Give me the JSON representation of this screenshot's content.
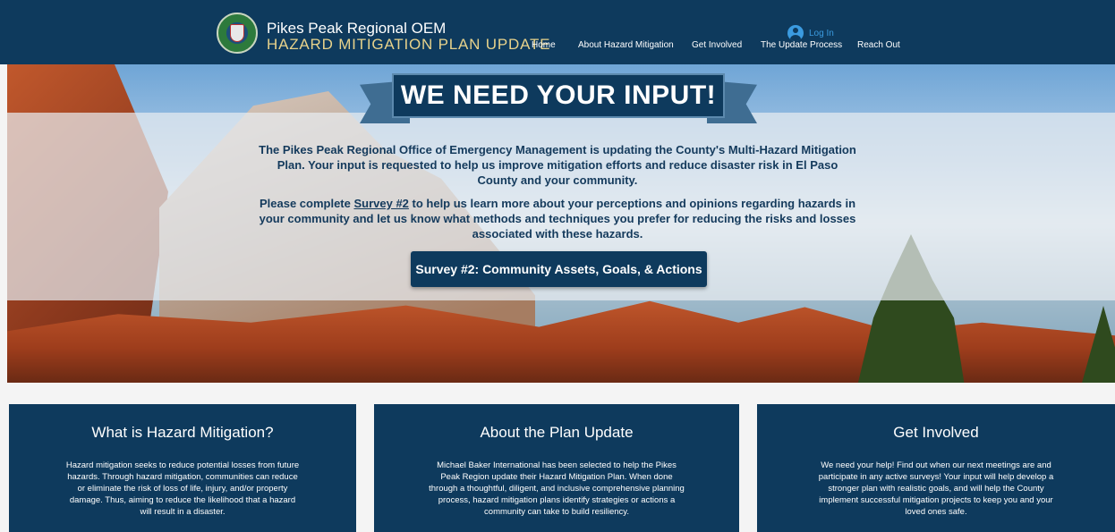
{
  "header": {
    "brand_line1": "Pikes Peak Regional OEM",
    "brand_line2": "HAZARD MITIGATION PLAN UPDATE",
    "nav": [
      "Home",
      "About Hazard Mitigation",
      "Get Involved",
      "The Update Process",
      "Reach Out"
    ],
    "login_label": "Log In"
  },
  "hero": {
    "banner": "WE NEED YOUR INPUT!",
    "paragraph1": "The Pikes Peak Regional Office of Emergency Management is updating the County's Multi-Hazard Mitigation Plan. Your input is requested to help us improve mitigation efforts and reduce disaster risk in El Paso County and your community.",
    "paragraph2_before": "Please complete ",
    "paragraph2_link": "Survey #2",
    "paragraph2_after": " to help us learn more about your perceptions and opinions regarding hazards in your community and let us know what methods and techniques you prefer for reducing the risks and losses associated with these hazards.",
    "cta": "Survey #2: Community Assets, Goals, & Actions"
  },
  "cards": [
    {
      "title": "What is Hazard Mitigation?",
      "body": "Hazard mitigation seeks to reduce potential losses from future hazards. Through hazard mitigation, communities can reduce or eliminate the risk of loss of life, injury, and/or property damage. Thus, aiming to reduce the likelihood that a hazard will result in a disaster."
    },
    {
      "title": "About the Plan Update",
      "body": "Michael Baker International has been selected to help the Pikes Peak Region update their Hazard Mitigation Plan. When done through a thoughtful, diligent, and inclusive comprehensive planning process, hazard mitigation plans identify strategies or actions a community can take to build resiliency."
    },
    {
      "title": "Get Involved",
      "body": "We need your help! Find out when our next meetings are and participate in any active surveys! Your input will help develop a stronger plan with realistic goals, and will help the County implement successful mitigation projects to keep you and your loved ones safe."
    }
  ],
  "colors": {
    "navy": "#0e3a5d",
    "gold": "#e7d28b",
    "link_blue": "#3b9be0",
    "hero_text": "#143a5c"
  }
}
